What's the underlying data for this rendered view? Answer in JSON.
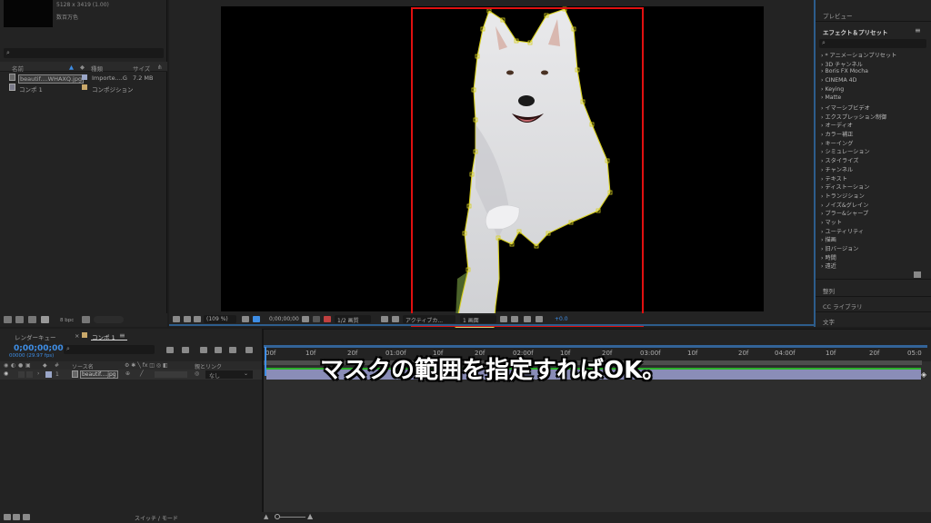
{
  "project": {
    "footage_meta_dims": "5128 x 3419 (1.00)",
    "footage_meta_color": "数百万色",
    "columns": {
      "name": "名前",
      "type": "種類",
      "size": "サイズ"
    },
    "items": [
      {
        "name": "beautif....WHAXQ.jpg",
        "type": "Importe....G",
        "size": "7.2 MB"
      },
      {
        "name": "コンポ 1",
        "type": "コンポジション",
        "size": ""
      }
    ],
    "bpc": "8 bpc"
  },
  "viewer": {
    "zoom": "(109 %)",
    "timecode": "0;00;00;00",
    "resolution": "1/2 画質",
    "camera": "アクティブカ...",
    "views": "1 画面",
    "exposure": "+0.0"
  },
  "right_panel": {
    "preview": "プレビュー",
    "effects_title": "エフェクト＆プリセット",
    "effects": [
      "* アニメーションプリセット",
      "3D チャンネル",
      "Boris FX Mocha",
      "CINEMA 4D",
      "Keying",
      "Matte",
      "イマーシブビデオ",
      "エクスプレッション制御",
      "オーディオ",
      "カラー補正",
      "キーイング",
      "シミュレーション",
      "スタイライズ",
      "チャンネル",
      "テキスト",
      "ディストーション",
      "トランジション",
      "ノイズ&グレイン",
      "ブラー&シャープ",
      "マット",
      "ユーティリティ",
      "描画",
      "旧バージョン",
      "時間",
      "遠近"
    ],
    "align": "整列",
    "libraries": "CC ライブラリ",
    "character": "文字"
  },
  "timeline": {
    "tab_render": "レンダーキュー",
    "tab_comp": "コンポ 1",
    "timecode": "0;00;00;00",
    "fps": "00000 (29.97 fps)",
    "header": {
      "num": "#",
      "source": "ソース名",
      "parent": "親とリンク"
    },
    "layer": {
      "index": "1",
      "name": "beautif....jpg",
      "parent": "なし"
    },
    "ruler": [
      "00f",
      "10f",
      "20f",
      "01:00f",
      "10f",
      "20f",
      "02:00f",
      "10f",
      "20f",
      "03:00f",
      "10f",
      "20f",
      "04:00f",
      "10f",
      "20f",
      "05:0"
    ],
    "switches": "スイッチ / モード"
  },
  "caption": "マスクの範囲を指定すればOK。"
}
